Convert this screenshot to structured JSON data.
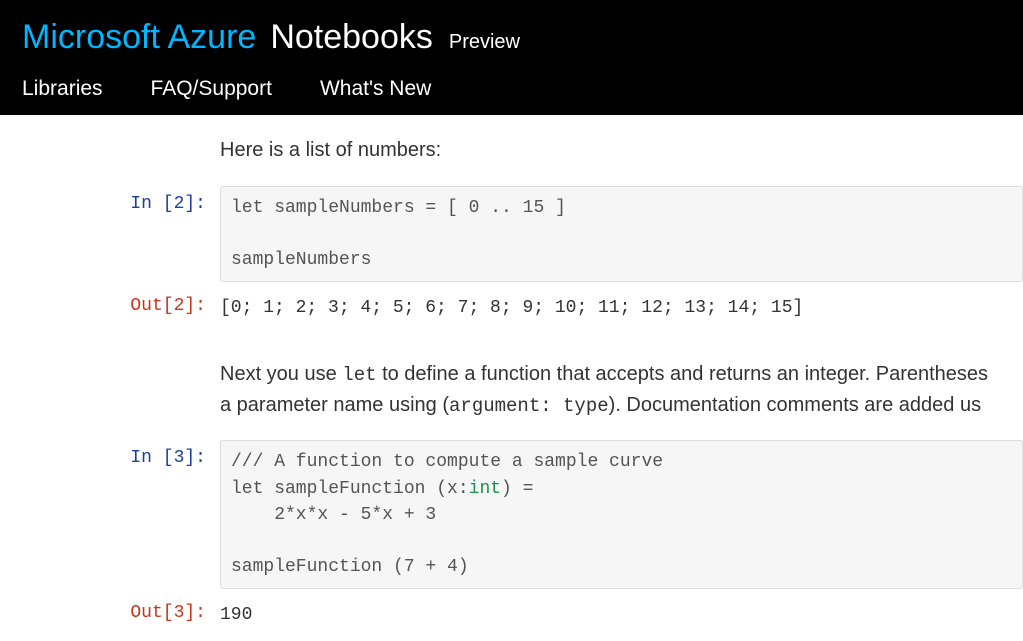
{
  "header": {
    "brand_azure": "Microsoft Azure",
    "brand_notebooks": "Notebooks",
    "brand_preview": "Preview",
    "nav": [
      {
        "label": "Libraries"
      },
      {
        "label": "FAQ/Support"
      },
      {
        "label": "What's New"
      }
    ]
  },
  "notebook": {
    "md1": "Here is a list of numbers:",
    "cells": [
      {
        "in_prompt": "In [2]:",
        "out_prompt": "Out[2]:",
        "code_line1": "let sampleNumbers = [ ",
        "code_num1": "0",
        "code_dots": " .. ",
        "code_num2": "15",
        "code_line1_end": " ]",
        "code_line2": "sampleNumbers",
        "output": "[0; 1; 2; 3; 4; 5; 6; 7; 8; 9; 10; 11; 12; 13; 14; 15]"
      },
      {
        "in_prompt": "In [3]:",
        "out_prompt": "Out[3]:",
        "code_line1": "/// A function to compute a sample curve",
        "code_line2a": "let sampleFunction (x:",
        "code_type": "int",
        "code_line2b": ") =",
        "code_line3": "    2*x*x - 5*x + 3",
        "code_line4": "sampleFunction (7 + 4)",
        "output": "190"
      }
    ],
    "md2_part1": "Next you use ",
    "md2_mono1": "let",
    "md2_part2": " to define a function that accepts and returns an integer. Parentheses",
    "md2_part3": "a parameter name using (",
    "md2_mono2": "argument: type",
    "md2_part4": "). Documentation comments are added us"
  }
}
